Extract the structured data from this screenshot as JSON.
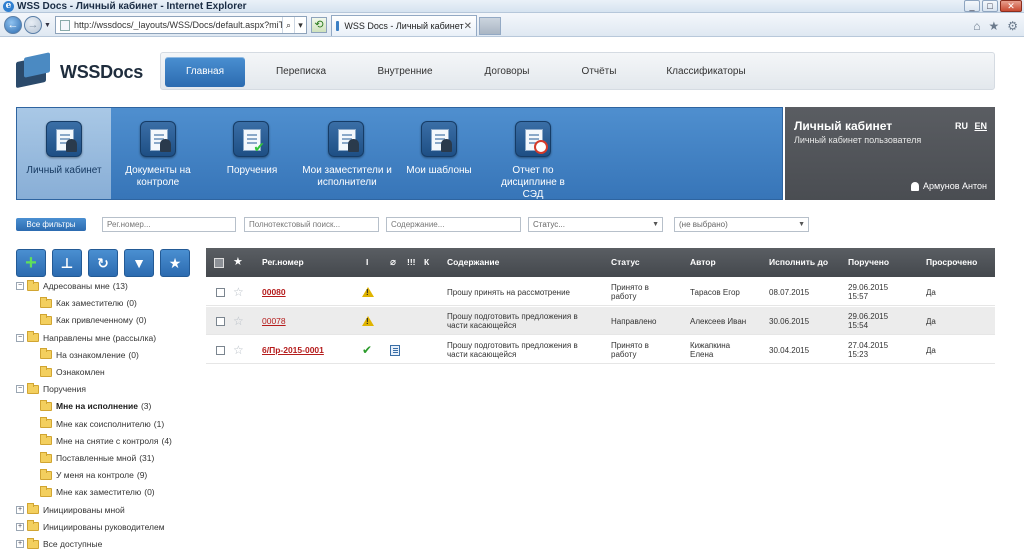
{
  "browser": {
    "window_title": "WSS Docs - Личный кабинет - Internet Explorer",
    "address": "http://wssdocs/_layouts/WSS/Docs/default.aspx?miTopI",
    "tab_label": "WSS Docs - Личный кабинет"
  },
  "app": {
    "logo_text": "WSSDocs"
  },
  "menu": [
    {
      "label": "Главная",
      "active": true
    },
    {
      "label": "Переписка"
    },
    {
      "label": "Внутренние"
    },
    {
      "label": "Договоры"
    },
    {
      "label": "Отчёты"
    },
    {
      "label": "Классификаторы"
    }
  ],
  "band": [
    {
      "label": "Личный кабинет",
      "icon": "personal-cabinet-icon",
      "active": true
    },
    {
      "label": "Документы на контроле",
      "icon": "documents-control-icon"
    },
    {
      "label": "Поручения",
      "icon": "assignments-icon"
    },
    {
      "label": "Мои заместители и исполнители",
      "icon": "deputies-icon"
    },
    {
      "label": "Мои шаблоны",
      "icon": "templates-icon"
    },
    {
      "label": "Отчет по дисциплине в СЭД",
      "icon": "discipline-report-icon"
    }
  ],
  "cabinet": {
    "title": "Личный кабинет",
    "subtitle": "Личный кабинет пользователя",
    "lang_ru": "RU",
    "lang_en": "EN",
    "user": "Армунов Антон"
  },
  "filters": {
    "all_filters": "Все фильтры",
    "reg_placeholder": "Рег.номер...",
    "fulltext_placeholder": "Полнотекстовый поиск...",
    "content_placeholder": "Содержание...",
    "status_value": "Статус...",
    "extra_value": "(не выбрано)"
  },
  "tree": [
    {
      "label": "Адресованы мне",
      "count": "(13)",
      "level": 0,
      "toggle": "−"
    },
    {
      "label": "Как заместителю",
      "count": "(0)",
      "level": 1
    },
    {
      "label": "Как привлеченному",
      "count": "(0)",
      "level": 1
    },
    {
      "label": "Направлены мне (рассылка)",
      "count": "",
      "level": 0,
      "toggle": "−"
    },
    {
      "label": "На ознакомление",
      "count": "(0)",
      "level": 1
    },
    {
      "label": "Ознакомлен",
      "count": "",
      "level": 1
    },
    {
      "label": "Поручения",
      "count": "",
      "level": 0,
      "toggle": "−"
    },
    {
      "label": "Мне на исполнение",
      "count": "(3)",
      "level": 1,
      "bold": true
    },
    {
      "label": "Мне как соисполнителю",
      "count": "(1)",
      "level": 1
    },
    {
      "label": "Мне на снятие с контроля",
      "count": "(4)",
      "level": 1
    },
    {
      "label": "Поставленные мной",
      "count": "(31)",
      "level": 1
    },
    {
      "label": "У меня на контроле",
      "count": "(9)",
      "level": 1
    },
    {
      "label": "Мне как заместителю",
      "count": "(0)",
      "level": 1
    },
    {
      "label": "Инициированы мной",
      "count": "",
      "level": 0,
      "toggle": "+"
    },
    {
      "label": "Инициированы руководителем",
      "count": "",
      "level": 0,
      "toggle": "+"
    },
    {
      "label": "Все доступные",
      "count": "",
      "level": 0,
      "toggle": "+"
    }
  ],
  "table": {
    "headers": {
      "reg": "Рег.номер",
      "i": "I",
      "excl": "!!!",
      "k": "К",
      "content": "Содержание",
      "status": "Статус",
      "author": "Автор",
      "due": "Исполнить до",
      "assigned": "Поручено",
      "overdue": "Просрочено"
    },
    "rows": [
      {
        "reg": "00080",
        "bold": true,
        "flag": "warning",
        "attach": "",
        "content": "Прошу принять на рассмотрение",
        "status": "Принято в работу",
        "author": "Тарасов Егор",
        "due": "08.07.2015",
        "assigned": "29.06.2015 15:57",
        "overdue": "Да"
      },
      {
        "reg": "00078",
        "bold": false,
        "flag": "warning",
        "attach": "",
        "content": "Прошу подготовить предложения в части касающейся",
        "status": "Направлено",
        "author": "Алексеев Иван",
        "due": "30.06.2015",
        "assigned": "29.06.2015 15:54",
        "overdue": "Да"
      },
      {
        "reg": "6/Пр-2015-0001",
        "bold": true,
        "flag": "done",
        "attach": "doc",
        "content": "Прошу подготовить предложения в части касающейся",
        "status": "Принято в работу",
        "author": "Кижапкина Елена",
        "due": "30.04.2015",
        "assigned": "27.04.2015 15:23",
        "overdue": "Да"
      }
    ]
  }
}
